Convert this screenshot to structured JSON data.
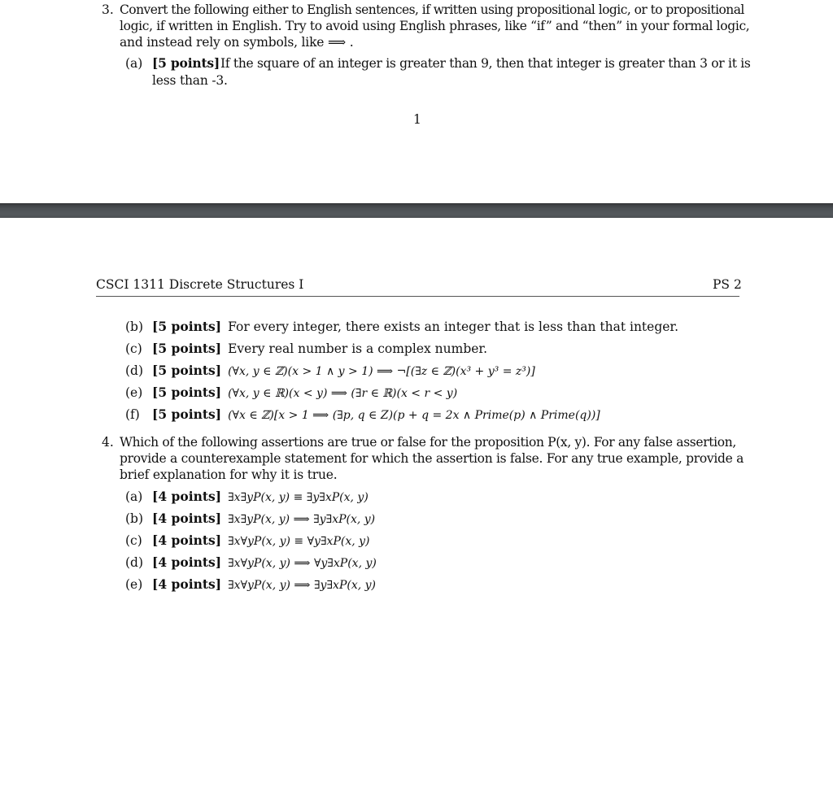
{
  "page1": {
    "q3": {
      "number": "3.",
      "lines": [
        "Convert the following either to English sentences, if written using propositional logic, or to propositional",
        "logic, if written in English. Try to avoid using English phrases, like “if” and “then” in your formal logic,",
        "and instead rely on symbols, like ⟹ ."
      ],
      "parts": [
        {
          "label": "(a)",
          "points": "[5 points]",
          "lines": [
            "If the square of an integer is greater than 9, then that integer is greater than 3 or it is",
            "less than -3."
          ]
        }
      ]
    },
    "page_number": "1"
  },
  "page2": {
    "header": {
      "course": "CSCI 1311 Discrete Structures I",
      "assignment": "PS 2"
    },
    "q3_parts": [
      {
        "label": "(b)",
        "points": "[5 points]",
        "text": "For every integer, there exists an integer that is less than that integer."
      },
      {
        "label": "(c)",
        "points": "[5 points]",
        "text": "Every real number is a complex number."
      },
      {
        "label": "(d)",
        "points": "[5 points]",
        "text": "(∀x, y ∈ ℤ)(x > 1 ∧ y > 1)  ⟹  ¬[(∃z ∈ ℤ)(x³ + y³ = z³)]"
      },
      {
        "label": "(e)",
        "points": "[5 points]",
        "text": "(∀x, y ∈ ℝ)(x < y)  ⟹  (∃r ∈ ℝ)(x < r < y)"
      },
      {
        "label": "(f)",
        "points": "[5 points]",
        "text": "(∀x ∈ ℤ)[x > 1  ⟹  (∃p, q ∈ Z)(p + q = 2x ∧ Prime(p) ∧ Prime(q))]"
      }
    ],
    "q4": {
      "number": "4.",
      "lines": [
        "Which of the following assertions are true or false for the proposition P(x, y). For any false assertion,",
        "provide a counterexample statement for which the assertion is false. For any true example, provide a",
        "brief explanation for why it is true."
      ],
      "parts": [
        {
          "label": "(a)",
          "points": "[4 points]",
          "text": "∃x∃yP(x, y) ≡ ∃y∃xP(x, y)"
        },
        {
          "label": "(b)",
          "points": "[4 points]",
          "text": "∃x∃yP(x, y)  ⟹  ∃y∃xP(x, y)"
        },
        {
          "label": "(c)",
          "points": "[4 points]",
          "text": "∃x∀yP(x, y) ≡ ∀y∃xP(x, y)"
        },
        {
          "label": "(d)",
          "points": "[4 points]",
          "text": "∃x∀yP(x, y)  ⟹  ∀y∃xP(x, y)"
        },
        {
          "label": "(e)",
          "points": "[4 points]",
          "text": "∃x∀yP(x, y)  ⟹  ∃y∃xP(x, y)"
        }
      ]
    }
  }
}
